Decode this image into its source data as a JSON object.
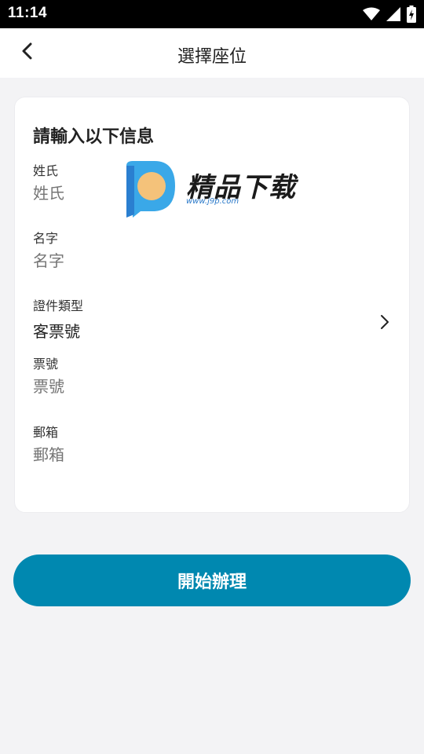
{
  "status_bar": {
    "time": "11:14",
    "icons": [
      "wifi-icon",
      "signal-icon",
      "battery-icon"
    ]
  },
  "header": {
    "title": "選擇座位",
    "back_icon": "chevron-left-icon"
  },
  "form": {
    "heading": "請輸入以下信息",
    "fields": [
      {
        "label": "姓氏",
        "placeholder": "姓氏",
        "value": ""
      },
      {
        "label": "名字",
        "placeholder": "名字",
        "value": ""
      },
      {
        "label": "證件類型",
        "value": "客票號",
        "icon": "chevron-right-icon"
      },
      {
        "label": "票號",
        "placeholder": "票號",
        "value": ""
      },
      {
        "label": "郵箱",
        "placeholder": "郵箱",
        "value": ""
      }
    ]
  },
  "watermark": {
    "text": "精品下载",
    "url": "www.j9p.com"
  },
  "start_button": {
    "label": "開始辦理"
  },
  "colors": {
    "accent": "#0088b0",
    "background": "#f3f3f5",
    "placeholder": "#b0b0b0"
  }
}
